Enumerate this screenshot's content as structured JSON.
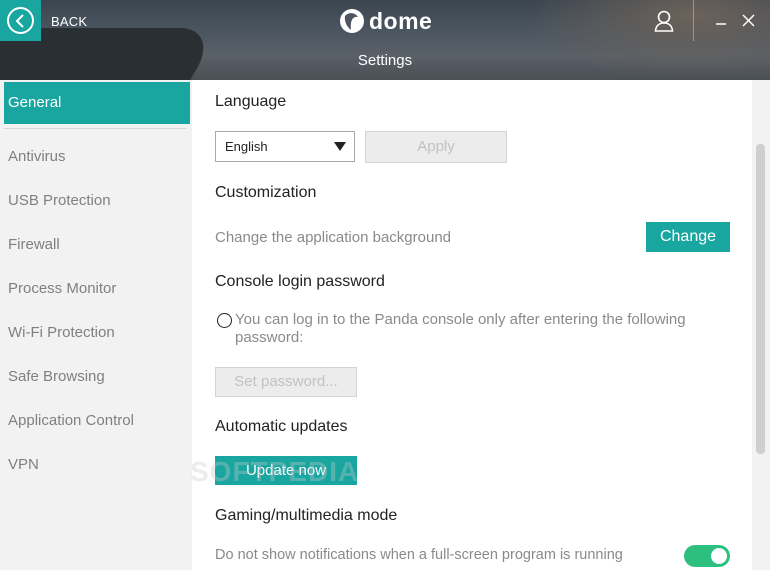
{
  "header": {
    "back_label": "BACK",
    "logo_text": "dome",
    "logo_small": "panda",
    "title": "Settings"
  },
  "sidebar": {
    "items": [
      {
        "label": "General",
        "active": true
      },
      {
        "label": "Antivirus",
        "active": false
      },
      {
        "label": "USB Protection",
        "active": false
      },
      {
        "label": "Firewall",
        "active": false
      },
      {
        "label": "Process Monitor",
        "active": false
      },
      {
        "label": "Wi-Fi Protection",
        "active": false
      },
      {
        "label": "Safe Browsing",
        "active": false
      },
      {
        "label": "Application Control",
        "active": false
      },
      {
        "label": "VPN",
        "active": false
      }
    ]
  },
  "main": {
    "language": {
      "heading": "Language",
      "selected": "English",
      "apply_label": "Apply"
    },
    "customization": {
      "heading": "Customization",
      "description": "Change the application background",
      "change_label": "Change"
    },
    "console_password": {
      "heading": "Console login password",
      "option_text": "You can log in to the Panda console only after entering the following password:",
      "set_password_label": "Set password..."
    },
    "updates": {
      "heading": "Automatic updates",
      "update_label": "Update now"
    },
    "gaming": {
      "heading": "Gaming/multimedia mode",
      "description": "Do not show notifications when a full-screen program is running",
      "toggle_on": true
    },
    "watermark": "SOFTPEDIA"
  },
  "colors": {
    "accent": "#1aa6a0",
    "toggle_on": "#2cbf7e"
  },
  "icons": {
    "back": "chevron-left-icon",
    "user": "user-icon",
    "minimize": "minimize-icon",
    "close": "close-icon"
  }
}
